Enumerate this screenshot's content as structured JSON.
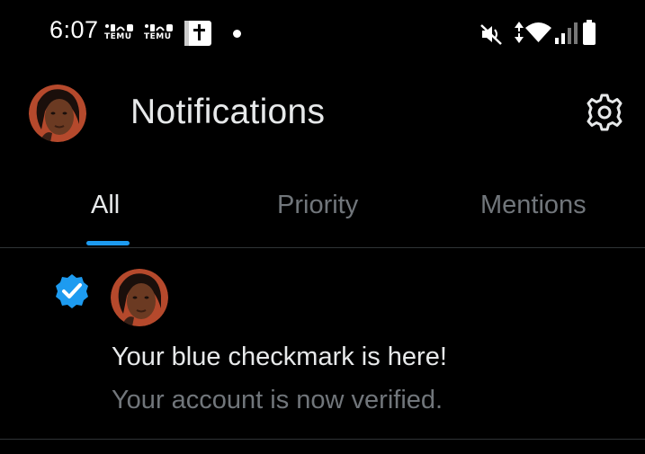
{
  "status_bar": {
    "time": "6:07",
    "badges": [
      {
        "text": "TEMU",
        "icon": "temu-app-icon"
      },
      {
        "text": "TEMU",
        "icon": "temu-app-icon"
      }
    ],
    "icons": [
      "bible-book-icon",
      "notification-dot-icon",
      "vibrate-mute-icon",
      "data-arrows-icon",
      "wifi-icon",
      "signal-icon",
      "battery-icon"
    ]
  },
  "header": {
    "title": "Notifications",
    "avatar_icon": "profile-avatar",
    "settings_icon": "gear-icon"
  },
  "tabs": [
    {
      "label": "All",
      "active": true
    },
    {
      "label": "Priority",
      "active": false
    },
    {
      "label": "Mentions",
      "active": false
    }
  ],
  "colors": {
    "background": "#000000",
    "primary_text": "#e7e9ea",
    "secondary_text": "#71767b",
    "accent": "#1d9bf0",
    "divider": "#2f3336"
  },
  "notifications": [
    {
      "icon": "verified-badge-icon",
      "title": "Your blue checkmark is here!",
      "body": "Your account is now verified."
    }
  ]
}
